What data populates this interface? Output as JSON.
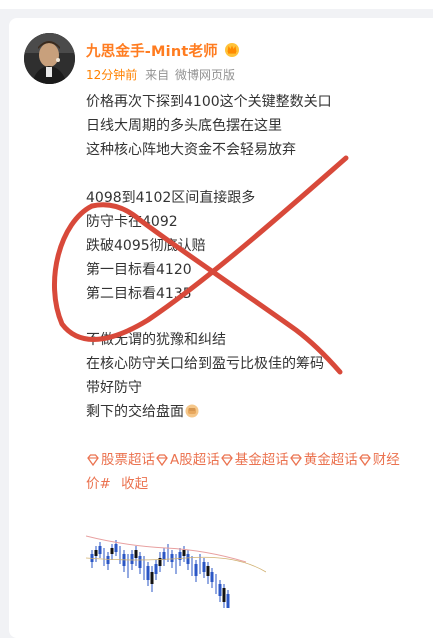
{
  "post": {
    "username": "九思金手-Mint老师",
    "time": "12分钟前",
    "source_prefix": "来自",
    "source": "微博网页版",
    "lines": [
      "价格再次下探到4100这个关键整数关口",
      "日线大周期的多头底色摆在这里",
      "这种核心阵地大资金不会轻易放弃",
      "4098到4102区间直接跟多",
      "防守卡在4092",
      "跌破4095彻底认赔",
      "第一目标看4120",
      "第二目标看4135",
      "不做无谓的犹豫和纠结",
      "在核心防守关口给到盈亏比极佳的筹码",
      "带好防守",
      "剩下的交给盘面"
    ],
    "topics": [
      "股票超话",
      "A股超话",
      "基金超话",
      "黄金超话",
      "财经"
    ],
    "topics_tail": "价#",
    "collapse_label": "收起"
  },
  "colors": {
    "accent_orange": "#ff8200",
    "username": "#ff7c20",
    "topic": "#eb7350",
    "xmark": "#d8493a",
    "text": "#333333"
  },
  "icons": {
    "crown": "crown-icon",
    "diamond": "diamond-icon",
    "emoji": "fist-emoji-icon"
  }
}
